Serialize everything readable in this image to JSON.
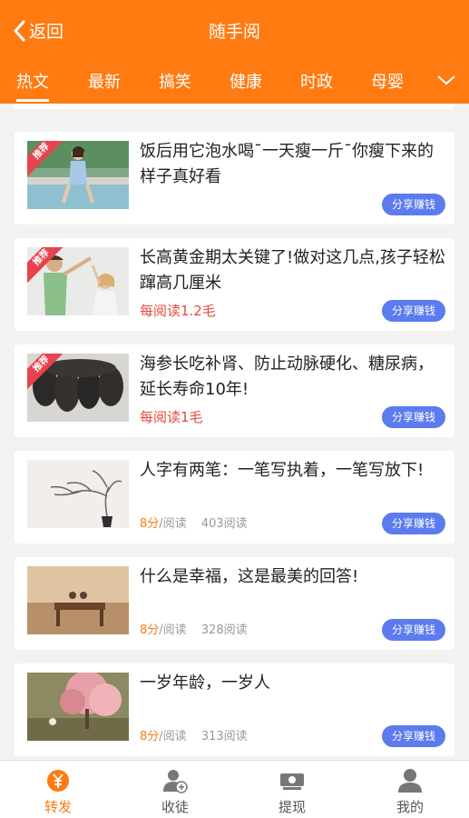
{
  "header": {
    "back_label": "返回",
    "title": "随手阅",
    "tabs": [
      "热文",
      "最新",
      "搞笑",
      "健康",
      "时政",
      "母婴"
    ],
    "active_tab": "热文"
  },
  "colors": {
    "brand": "#ff7a10",
    "share_button": "#5b7bee",
    "reward_text": "#e84a3c",
    "recommend_ribbon": "#e8424f"
  },
  "articles": [
    {
      "title": "饭后用它泡水喝¯一天瘦一斤¯你瘦下来的样子真好看",
      "badge": "推荐",
      "share": "分享赚钱"
    },
    {
      "title": "长高黄金期太关键了!做对这几点,孩子轻松蹿高几厘米",
      "badge": "推荐",
      "reward": "每阅读1.2毛",
      "share": "分享赚钱"
    },
    {
      "title": "海参长吃补肾、防止动脉硬化、糖尿病，延长寿命10年!",
      "badge": "推荐",
      "reward": "每阅读1毛",
      "share": "分享赚钱"
    },
    {
      "title": "人字有两笔：一笔写执着，一笔写放下!",
      "score": "8分",
      "score_suffix": "/阅读",
      "reads": "403阅读",
      "share": "分享赚钱"
    },
    {
      "title": "什么是幸福，这是最美的回答!",
      "score": "8分",
      "score_suffix": "/阅读",
      "reads": "328阅读",
      "share": "分享赚钱"
    },
    {
      "title": "一岁年龄，一岁人",
      "score": "8分",
      "score_suffix": "/阅读",
      "reads": "313阅读",
      "share": "分享赚钱"
    }
  ],
  "bottom_nav": [
    {
      "label": "转发",
      "icon": "yen-coin-icon",
      "active": true
    },
    {
      "label": "收徒",
      "icon": "add-user-icon",
      "active": false
    },
    {
      "label": "提现",
      "icon": "cash-icon",
      "active": false
    },
    {
      "label": "我的",
      "icon": "profile-icon",
      "active": false
    }
  ]
}
